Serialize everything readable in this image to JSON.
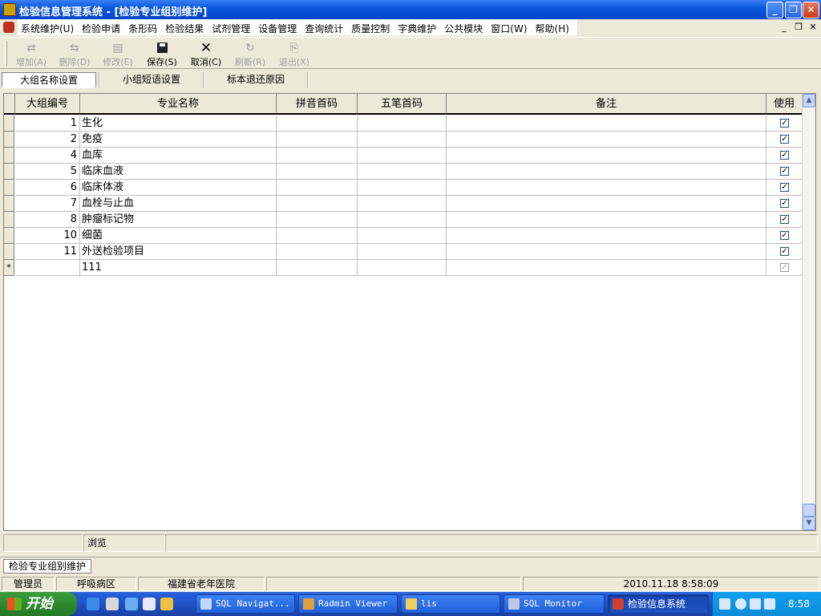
{
  "window": {
    "title": "检验信息管理系统 - [检验专业组别维护]"
  },
  "menu": {
    "items": [
      "系统维护(U)",
      "检验申请",
      "条形码",
      "检验结果",
      "试剂管理",
      "设备管理",
      "查询统计",
      "质量控制",
      "字典维护",
      "公共模块",
      "窗口(W)",
      "帮助(H)"
    ]
  },
  "toolbar": {
    "add": "增加(A)",
    "delete": "删除(D)",
    "edit": "修改(E)",
    "save": "保存(S)",
    "cancel": "取消(C)",
    "refresh": "刷新(R)",
    "exit": "退出(X)"
  },
  "tabs": [
    "大组名称设置",
    "小组短语设置",
    "标本退还原因"
  ],
  "grid": {
    "columns": [
      "大组编号",
      "专业名称",
      "拼音首码",
      "五笔首码",
      "备注",
      "使用"
    ],
    "rows": [
      {
        "id": "1",
        "name": "生化",
        "pinyin": "",
        "wubi": "",
        "note": "",
        "used": true
      },
      {
        "id": "2",
        "name": "免疫",
        "pinyin": "",
        "wubi": "",
        "note": "",
        "used": true
      },
      {
        "id": "4",
        "name": "血库",
        "pinyin": "",
        "wubi": "",
        "note": "",
        "used": true
      },
      {
        "id": "5",
        "name": "临床血液",
        "pinyin": "",
        "wubi": "",
        "note": "",
        "used": true
      },
      {
        "id": "6",
        "name": "临床体液",
        "pinyin": "",
        "wubi": "",
        "note": "",
        "used": true
      },
      {
        "id": "7",
        "name": "血栓与止血",
        "pinyin": "",
        "wubi": "",
        "note": "",
        "used": true
      },
      {
        "id": "8",
        "name": "肿瘤标记物",
        "pinyin": "",
        "wubi": "",
        "note": "",
        "used": true
      },
      {
        "id": "10",
        "name": "细菌",
        "pinyin": "",
        "wubi": "",
        "note": "",
        "used": true
      },
      {
        "id": "11",
        "name": "外送检验项目",
        "pinyin": "",
        "wubi": "",
        "note": "",
        "used": true
      }
    ],
    "new_row": {
      "marker": "*",
      "id": "",
      "name": "111",
      "used": true
    }
  },
  "status": {
    "mode": "浏览",
    "mdi_tab": "检验专业组别维护",
    "user": "管理员",
    "ward": "呼吸病区",
    "hospital": "福建省老年医院",
    "datetime": "2010.11.18 8:58:09"
  },
  "taskbar": {
    "start": "开始",
    "tasks": [
      "SQL Navigat...",
      "Radmin Viewer",
      "lis",
      "SQL Monitor",
      "检验信息系统"
    ],
    "clock": "8:58"
  }
}
